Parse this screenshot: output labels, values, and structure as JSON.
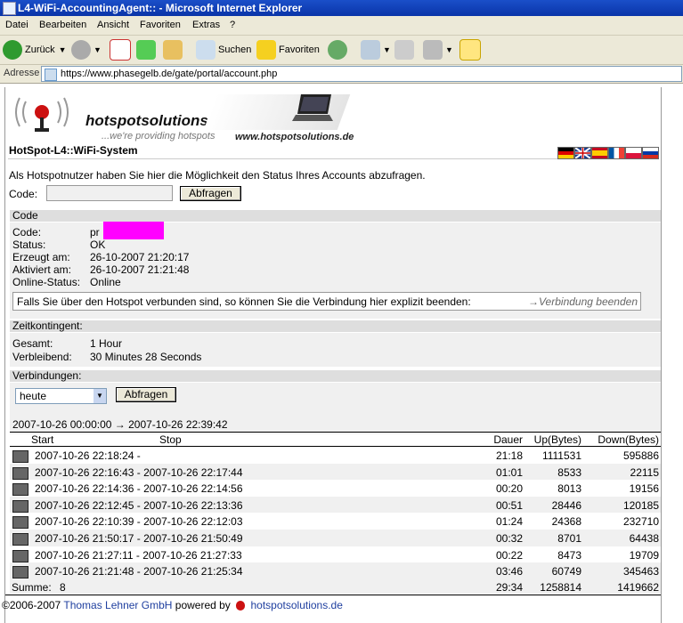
{
  "window": {
    "title": "L4-WiFi-AccountingAgent:: - Microsoft Internet Explorer"
  },
  "menu": [
    "Datei",
    "Bearbeiten",
    "Ansicht",
    "Favoriten",
    "Extras",
    "?"
  ],
  "toolbar": {
    "back": "Zurück",
    "search": "Suchen",
    "favorites": "Favoriten"
  },
  "address": {
    "label": "Adresse",
    "url": "https://www.phasegelb.de/gate/portal/account.php"
  },
  "header": {
    "brand": "hotspotsolutions.de",
    "tagline": "...we're providing hotspots",
    "website": "www.hotspotsolutions.de",
    "system_title": "HotSpot-L4::WiFi-System"
  },
  "intro": "Als Hotspotnutzer haben Sie hier die Möglichkeit den Status Ihres Accounts abzufragen.",
  "code_form": {
    "label": "Code:",
    "value": "",
    "button": "Abfragen"
  },
  "code_section": {
    "title": "Code",
    "fields": [
      {
        "label": "Code:",
        "value": "pr"
      },
      {
        "label": "Status:",
        "value": "OK"
      },
      {
        "label": "Erzeugt am:",
        "value": "26-10-2007 21:20:17"
      },
      {
        "label": "Aktiviert am:",
        "value": "26-10-2007 21:21:48"
      },
      {
        "label": "Online-Status:",
        "value": "Online"
      }
    ],
    "disconnect_text": "Falls Sie über den Hotspot verbunden sind, so können Sie die Verbindung hier explizit beenden:",
    "disconnect_link": "→Verbindung beenden"
  },
  "zeit_section": {
    "title": "Zeitkontingent:",
    "fields": [
      {
        "label": "Gesamt:",
        "value": "1 Hour"
      },
      {
        "label": "Verbleibend:",
        "value": "30 Minutes 28 Seconds"
      }
    ]
  },
  "verbindungen": {
    "title": "Verbindungen:",
    "select_value": "heute",
    "button": "Abfragen",
    "range": "2007-10-26 00:00:00 → 2007-10-26 22:39:42",
    "columns": {
      "start": "Start",
      "stop": "Stop",
      "dauer": "Dauer",
      "up": "Up(Bytes)",
      "down": "Down(Bytes)"
    },
    "rows": [
      {
        "range": "2007-10-26 22:18:24 -",
        "dauer": "21:18",
        "up": "1111531",
        "down": "595886"
      },
      {
        "range": "2007-10-26 22:16:43 - 2007-10-26 22:17:44",
        "dauer": "01:01",
        "up": "8533",
        "down": "22115"
      },
      {
        "range": "2007-10-26 22:14:36 - 2007-10-26 22:14:56",
        "dauer": "00:20",
        "up": "8013",
        "down": "19156"
      },
      {
        "range": "2007-10-26 22:12:45 - 2007-10-26 22:13:36",
        "dauer": "00:51",
        "up": "28446",
        "down": "120185"
      },
      {
        "range": "2007-10-26 22:10:39 - 2007-10-26 22:12:03",
        "dauer": "01:24",
        "up": "24368",
        "down": "232710"
      },
      {
        "range": "2007-10-26 21:50:17 - 2007-10-26 21:50:49",
        "dauer": "00:32",
        "up": "8701",
        "down": "64438"
      },
      {
        "range": "2007-10-26 21:27:11 - 2007-10-26 21:27:33",
        "dauer": "00:22",
        "up": "8473",
        "down": "19709"
      },
      {
        "range": "2007-10-26 21:21:48 - 2007-10-26 21:25:34",
        "dauer": "03:46",
        "up": "60749",
        "down": "345463"
      }
    ],
    "summary": {
      "label": "Summe:",
      "count": "8",
      "dauer": "29:34",
      "up": "1258814",
      "down": "1419662"
    }
  },
  "footer": {
    "copyright": "©2006-2007",
    "company": "Thomas Lehner GmbH",
    "powered": "powered by",
    "brand": "hotspotsolutions.de"
  },
  "colors": {
    "title_bar": "#0a34a8",
    "section_bg": "#dedede",
    "redaction": "#ff00ff",
    "link": "#1f3f9f"
  }
}
